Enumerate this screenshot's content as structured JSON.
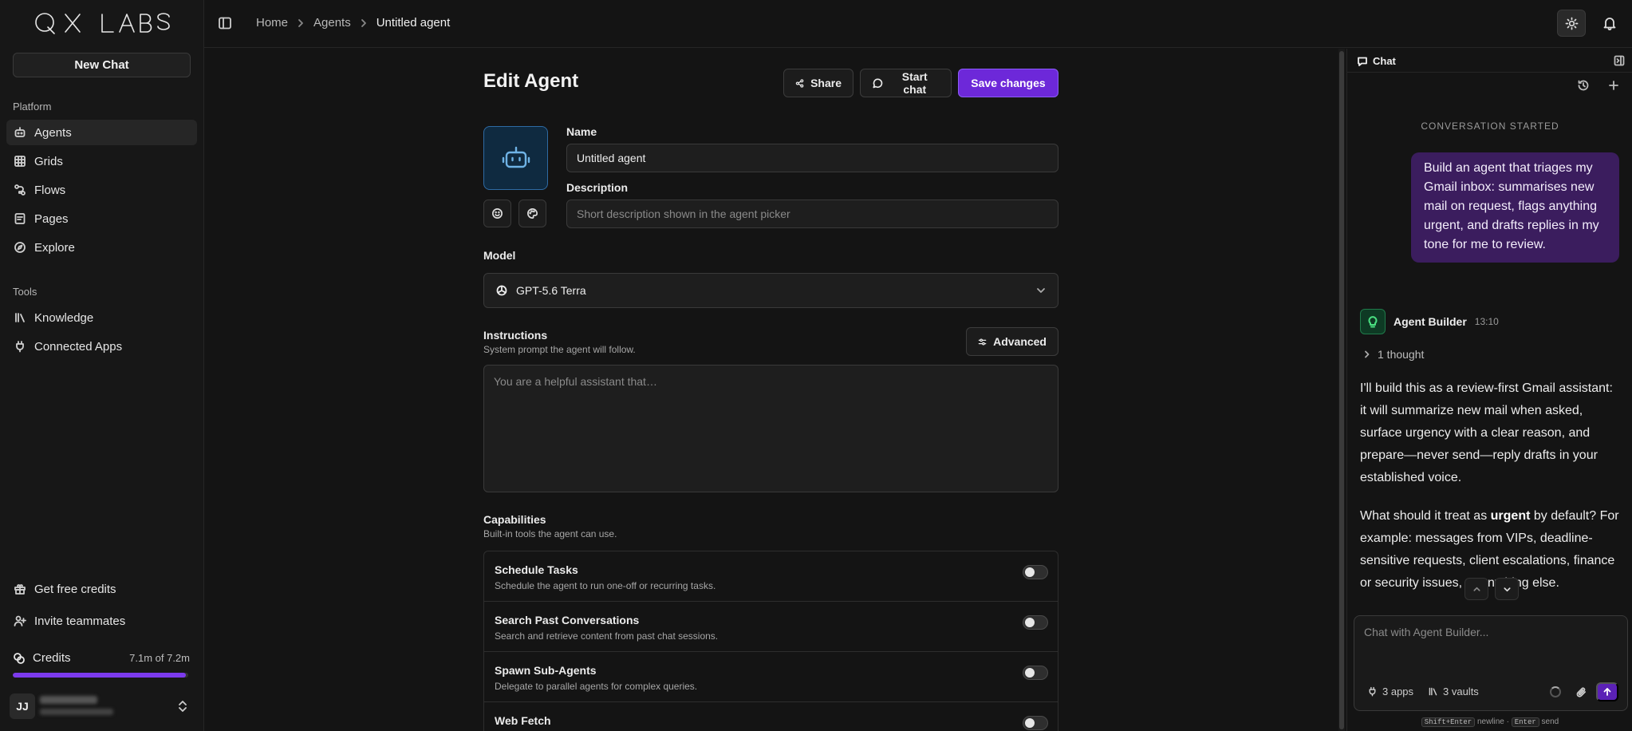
{
  "brand": {
    "logo_text": "QX LABS"
  },
  "sidebar": {
    "new_chat_label": "New Chat",
    "platform_label": "Platform",
    "platform_items": [
      {
        "label": "Agents",
        "icon": "robot-icon",
        "active": true
      },
      {
        "label": "Grids",
        "icon": "grid-icon"
      },
      {
        "label": "Flows",
        "icon": "flow-icon"
      },
      {
        "label": "Pages",
        "icon": "page-icon"
      },
      {
        "label": "Explore",
        "icon": "compass-icon"
      }
    ],
    "tools_label": "Tools",
    "tools_items": [
      {
        "label": "Knowledge",
        "icon": "library-icon"
      },
      {
        "label": "Connected Apps",
        "icon": "plug-icon"
      }
    ],
    "footer_items": [
      {
        "label": "Get free credits",
        "icon": "gift-icon"
      },
      {
        "label": "Invite teammates",
        "icon": "user-plus-icon"
      }
    ],
    "credits": {
      "label": "Credits",
      "value": "7.1m of 7.2m",
      "fraction": 0.986,
      "bar_color": "#7c3aed"
    },
    "user": {
      "initials": "JJ"
    }
  },
  "topbar": {
    "breadcrumbs": [
      "Home",
      "Agents",
      "Untitled agent"
    ]
  },
  "editor": {
    "title": "Edit Agent",
    "share_label": "Share",
    "start_chat_label": "Start chat",
    "save_label": "Save changes",
    "name_label": "Name",
    "name_value": "Untitled agent",
    "description_label": "Description",
    "description_placeholder": "Short description shown in the agent picker",
    "model_label": "Model",
    "model_value": "GPT-5.6 Terra",
    "instructions_label": "Instructions",
    "instructions_sub": "System prompt the agent will follow.",
    "instructions_placeholder": "You are a helpful assistant that…",
    "advanced_label": "Advanced",
    "capabilities_label": "Capabilities",
    "capabilities_sub": "Built-in tools the agent can use.",
    "capabilities": [
      {
        "title": "Schedule Tasks",
        "desc": "Schedule the agent to run one-off or recurring tasks.",
        "enabled": false
      },
      {
        "title": "Search Past Conversations",
        "desc": "Search and retrieve content from past chat sessions.",
        "enabled": false
      },
      {
        "title": "Spawn Sub-Agents",
        "desc": "Delegate to parallel agents for complex queries.",
        "enabled": false
      },
      {
        "title": "Web Fetch",
        "desc": "",
        "enabled": false
      }
    ],
    "accent_color": "#6d28d9"
  },
  "chat": {
    "title": "Chat",
    "conversation_started": "CONVERSATION STARTED",
    "user_message": "Build an agent that triages my Gmail inbox: summarises new mail on request, flags anything urgent, and drafts replies in my tone for me to review.",
    "assistant_name": "Agent Builder",
    "assistant_time": "13:10",
    "thought_label": "1 thought",
    "reply_p1": "I'll build this as a review-first Gmail assistant: it will summarize new mail when asked, surface urgency with a clear reason, and prepare—never send—reply drafts in your established voice.",
    "reply_p2_pre": "What should it treat as ",
    "reply_p2_bold": "urgent",
    "reply_p2_post": " by default? For example: messages from VIPs, deadline-sensitive requests, client escalations, finance or security issues, or anything else.",
    "composer_placeholder": "Chat with Agent Builder...",
    "apps_label": "3 apps",
    "vaults_label": "3 vaults",
    "hint_key1": "Shift+Enter",
    "hint_text1": " newline · ",
    "hint_key2": "Enter",
    "hint_text2": " send"
  }
}
